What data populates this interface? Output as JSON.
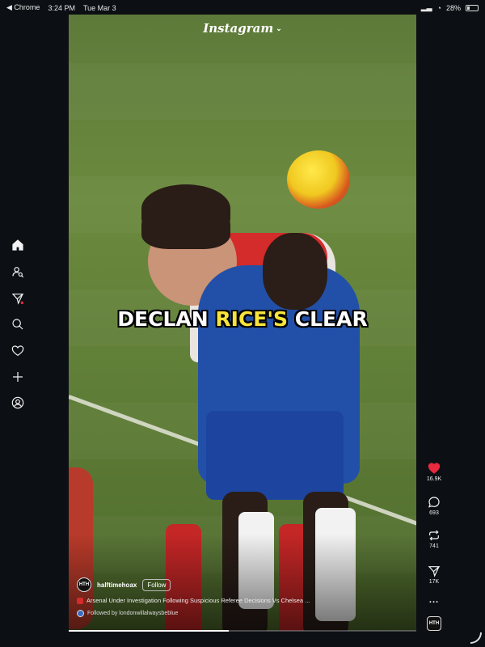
{
  "statusbar": {
    "back_app": "◀ Chrome",
    "time": "3:24 PM",
    "date": "Tue Mar 3",
    "battery_text": "28%",
    "battery_level": 0.28
  },
  "nav": {
    "items": [
      {
        "name": "home-icon"
      },
      {
        "name": "profile-search-icon"
      },
      {
        "name": "explore-icon"
      },
      {
        "name": "search-icon"
      },
      {
        "name": "heart-icon"
      },
      {
        "name": "plus-icon"
      },
      {
        "name": "account-icon"
      }
    ]
  },
  "header": {
    "logo": "Instagram",
    "chevron": "⌄"
  },
  "video": {
    "caption_part1": "DECLAN ",
    "caption_highlight": "RICE'S",
    "caption_part2": " CLEAR",
    "progress": 0.46
  },
  "post": {
    "avatar_text": "HTH",
    "username": "halftimehoax",
    "follow_label": "Follow",
    "description": "Arsenal Under Investigation Following Suspicious Referee Decisions Vs Chelsea ...",
    "followed_by": "Followed by londonwillalwaysbeblue"
  },
  "actions": {
    "likes": "16.9K",
    "comments": "693",
    "reposts": "741",
    "shares": "17K",
    "more": "...",
    "like_color": "#e8293e"
  }
}
